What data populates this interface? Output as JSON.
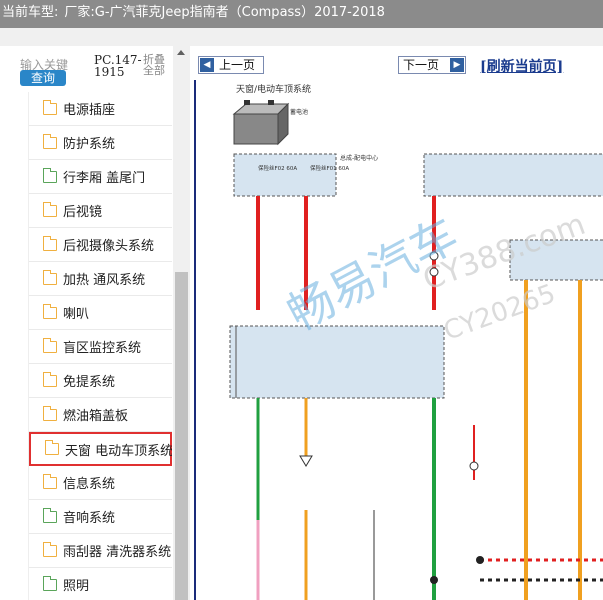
{
  "titlebar": {
    "model_label": "当前车型:",
    "manufacturer": "厂家:G-广汽菲克Jeep指南者（Compass）2017-2018"
  },
  "search": {
    "keyword_label": "输入关键",
    "query_button": "查询",
    "pc_code": "PC.147-1915",
    "fold_all": "折叠全部"
  },
  "tree": {
    "items": [
      {
        "label": "电源插座",
        "open": false,
        "selected": false
      },
      {
        "label": "防护系统",
        "open": false,
        "selected": false
      },
      {
        "label": "行李厢 盖尾门",
        "open": true,
        "selected": false
      },
      {
        "label": "后视镜",
        "open": false,
        "selected": false
      },
      {
        "label": "后视摄像头系统",
        "open": false,
        "selected": false
      },
      {
        "label": "加热 通风系统",
        "open": false,
        "selected": false
      },
      {
        "label": "喇叭",
        "open": false,
        "selected": false
      },
      {
        "label": "盲区监控系统",
        "open": false,
        "selected": false
      },
      {
        "label": "免提系统",
        "open": false,
        "selected": false
      },
      {
        "label": "燃油箱盖板",
        "open": false,
        "selected": false
      },
      {
        "label": "天窗 电动车顶系统",
        "open": false,
        "selected": true
      },
      {
        "label": "信息系统",
        "open": false,
        "selected": false
      },
      {
        "label": "音响系统",
        "open": true,
        "selected": false
      },
      {
        "label": "雨刮器 清洗器系统",
        "open": false,
        "selected": false
      },
      {
        "label": "照明",
        "open": true,
        "selected": false
      }
    ]
  },
  "toolbar": {
    "prev_label": "上一页",
    "next_label": "下一页",
    "refresh_label": "[刷新当前页]"
  },
  "diagram": {
    "page_title": "天窗/电动车顶系统",
    "battery_label": "蓄电池",
    "box1_label": "总成-配电中心",
    "fuse_f02": "保险丝F02 60A",
    "fuse_f01": "保险丝F01 60A",
    "watermark_text": "畅易汽车",
    "watermark_site": "CY388.com",
    "watermark_code": "CY20265",
    "colors": {
      "red": "#e02020",
      "orange": "#f0a020",
      "green": "#20a040",
      "pink": "#f0a0c0",
      "box_fill": "#d6e4f0",
      "box_border": "#555555"
    }
  }
}
